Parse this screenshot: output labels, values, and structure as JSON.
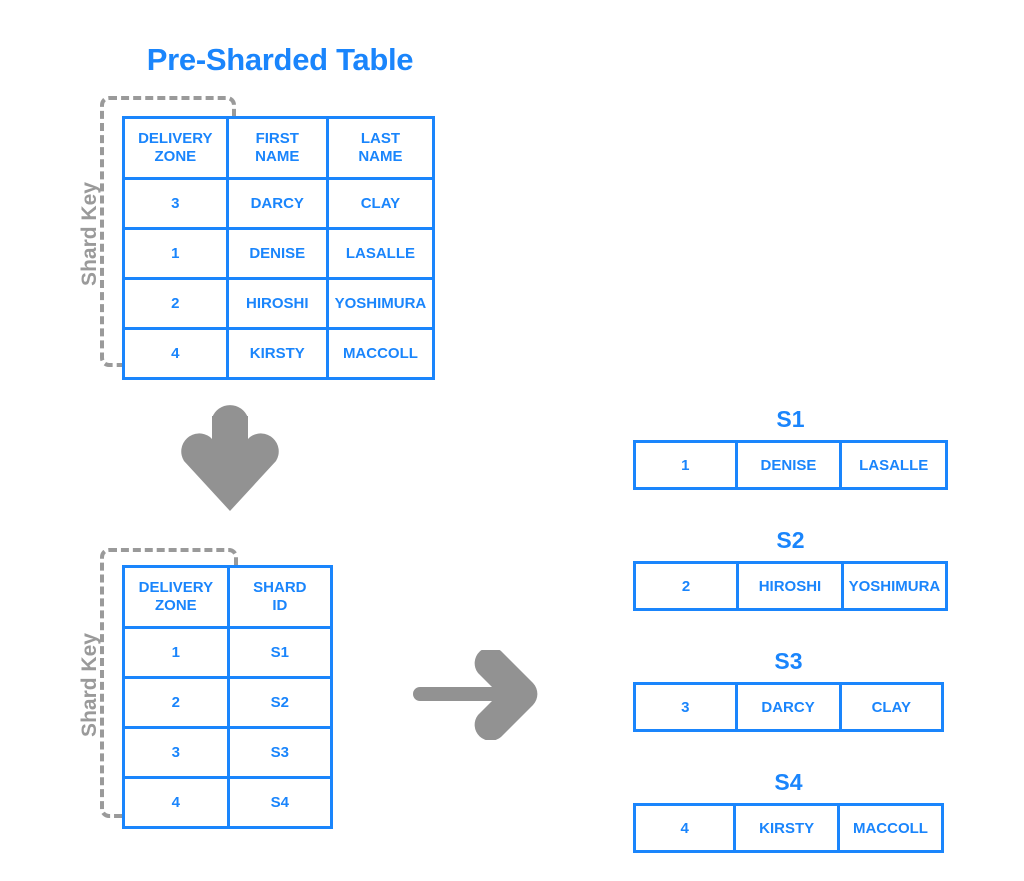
{
  "title": "Pre-Sharded Table",
  "colors": {
    "accent_blue": "#1a85fc",
    "gray": "#9a9a9a",
    "arrow_gray": "#929292",
    "background": "#ffffff"
  },
  "shard_key_label": "Shard Key",
  "presharded_table": {
    "headers": [
      "DELIVERY\nZONE",
      "FIRST\nNAME",
      "LAST\nNAME"
    ],
    "rows": [
      [
        "3",
        "DARCY",
        "CLAY"
      ],
      [
        "1",
        "DENISE",
        "LASALLE"
      ],
      [
        "2",
        "HIROSHI",
        "YOSHIMURA"
      ],
      [
        "4",
        "KIRSTY",
        "MACCOLL"
      ]
    ]
  },
  "shard_map_table": {
    "headers": [
      "DELIVERY\nZONE",
      "SHARD\nID"
    ],
    "rows": [
      [
        "1",
        "S1"
      ],
      [
        "2",
        "S2"
      ],
      [
        "3",
        "S3"
      ],
      [
        "4",
        "S4"
      ]
    ]
  },
  "shards": [
    {
      "title": "S1",
      "cells": [
        "1",
        "DENISE",
        "LASALLE"
      ]
    },
    {
      "title": "S2",
      "cells": [
        "2",
        "HIROSHI",
        "YOSHIMURA"
      ]
    },
    {
      "title": "S3",
      "cells": [
        "3",
        "DARCY",
        "CLAY"
      ]
    },
    {
      "title": "S4",
      "cells": [
        "4",
        "KIRSTY",
        "MACCOLL"
      ]
    }
  ],
  "icons": {
    "down_arrow": "arrow-down-icon",
    "right_arrow": "arrow-right-icon"
  }
}
